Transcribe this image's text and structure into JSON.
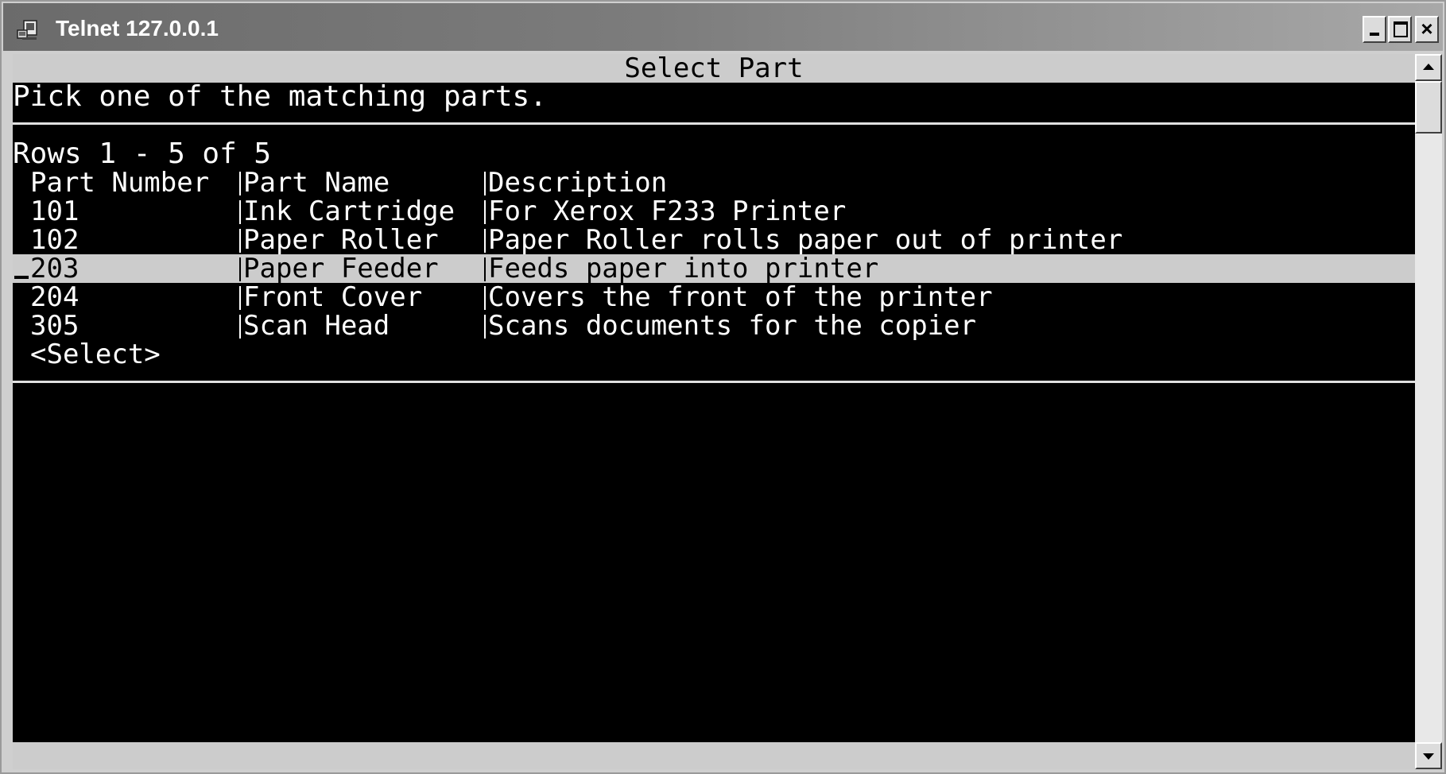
{
  "window": {
    "title": "Telnet 127.0.0.1",
    "icon": "telnet-terminal-icon",
    "controls": {
      "minimize": "minimize-icon",
      "maximize": "maximize-icon",
      "close": "×"
    }
  },
  "screen": {
    "header": "Select Part",
    "prompt": "Pick one of the matching parts.",
    "rows_info": "Rows 1 - 5 of 5",
    "columns": [
      "Part Number",
      "Part Name",
      "Description"
    ],
    "rows": [
      {
        "part_number": "101",
        "part_name": "Ink Cartridge",
        "description": "For Xerox F233 Printer",
        "selected": false
      },
      {
        "part_number": "102",
        "part_name": "Paper Roller",
        "description": "Paper Roller rolls paper out of printer",
        "selected": false
      },
      {
        "part_number": "203",
        "part_name": "Paper Feeder",
        "description": "Feeds paper into printer",
        "selected": true
      },
      {
        "part_number": "204",
        "part_name": "Front Cover",
        "description": "Covers the front of the printer",
        "selected": false
      },
      {
        "part_number": "305",
        "part_name": "Scan Head",
        "description": "Scans documents for the copier",
        "selected": false
      }
    ],
    "select_action": "<Select>"
  },
  "colors": {
    "terminal_bg": "#000000",
    "terminal_fg": "#ffffff",
    "highlight_bg": "#cccccc",
    "highlight_fg": "#000000"
  }
}
